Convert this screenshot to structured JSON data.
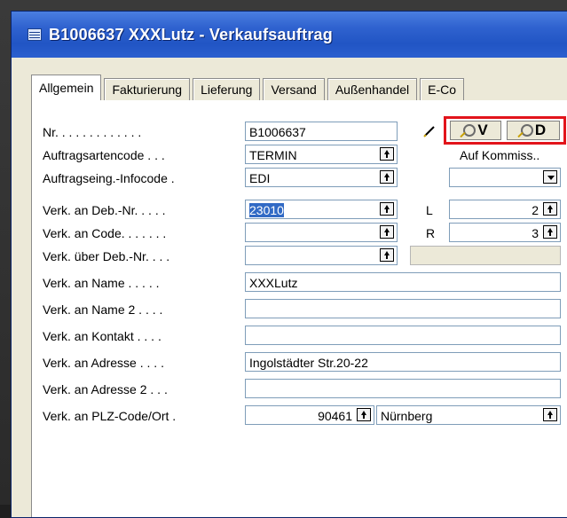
{
  "window": {
    "title": "B1006637 XXXLutz - Verkaufsauftrag"
  },
  "tabs": [
    "Allgemein",
    "Fakturierung",
    "Lieferung",
    "Versand",
    "Außenhandel",
    "E-Co"
  ],
  "toolbar": {
    "btn_v": "V",
    "btn_d": "D"
  },
  "fields": {
    "nr": {
      "label": "Nr. . . . . . . . . . . . .",
      "value": "B1006637"
    },
    "auftragsart": {
      "label": "Auftragsartencode . . .",
      "value": "TERMIN"
    },
    "auftragseing": {
      "label": "Auftragseing.-Infocode .",
      "value": "EDI"
    },
    "deb_nr": {
      "label": "Verk. an Deb.-Nr. . . . .",
      "value": "23010"
    },
    "code": {
      "label": "Verk. an Code. . . . . . .",
      "value": ""
    },
    "ueber_deb": {
      "label": "Verk. über Deb.-Nr. . . .",
      "value": ""
    },
    "name": {
      "label": "Verk. an Name . . . . .",
      "value": "XXXLutz"
    },
    "name2": {
      "label": "Verk. an Name 2 . . . .",
      "value": ""
    },
    "kontakt": {
      "label": "Verk. an Kontakt . . . .",
      "value": ""
    },
    "adresse": {
      "label": "Verk. an Adresse . . . .",
      "value": "Ingolstädter Str.20-22"
    },
    "adresse2": {
      "label": "Verk. an Adresse 2 . . .",
      "value": ""
    },
    "plz": {
      "label": "Verk. an PLZ-Code/Ort .",
      "value": "90461",
      "ort": "Nürnberg"
    }
  },
  "right": {
    "kommiss_label": "Auf Kommiss..",
    "l_label": "L",
    "l_value": "2",
    "r_label": "R",
    "r_value": "3"
  }
}
